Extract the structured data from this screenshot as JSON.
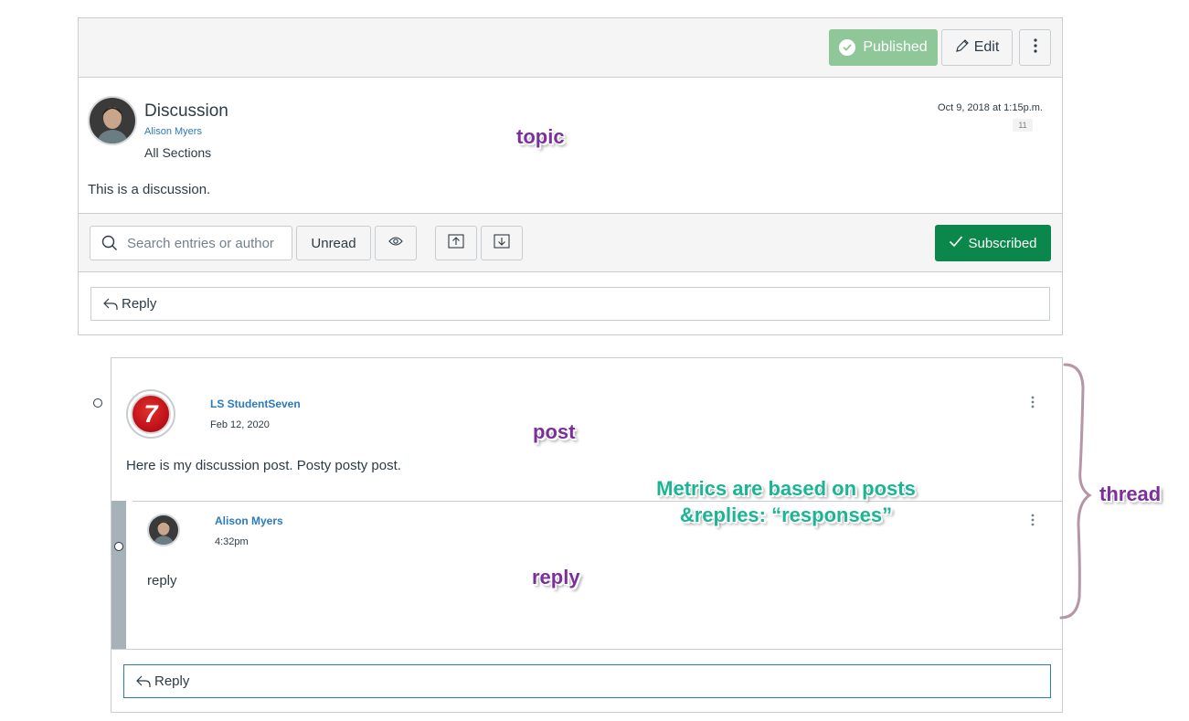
{
  "topic": {
    "published_label": "Published",
    "edit_label": "Edit",
    "title": "Discussion",
    "author": "Alison Myers",
    "sections": "All Sections",
    "date": "Oct 9, 2018 at 1:15p.m.",
    "count": "11",
    "body": "This is a discussion."
  },
  "toolbar": {
    "search_placeholder": "Search entries or author",
    "unread_label": "Unread",
    "subscribed_label": "Subscribed"
  },
  "topic_reply": {
    "label": "Reply"
  },
  "thread": {
    "post": {
      "avatar_text": "7",
      "author": "LS StudentSeven",
      "date": "Feb 12, 2020",
      "body": "Here is my discussion post. Posty posty post."
    },
    "reply": {
      "author": "Alison Myers",
      "date": "4:32pm",
      "body": "reply"
    },
    "reply_bar_label": "Reply"
  },
  "annotations": {
    "topic": "topic",
    "post": "post",
    "reply": "reply",
    "thread": "thread",
    "metrics_line1": "Metrics are based on posts",
    "metrics_line2": "&replies: “responses”"
  },
  "colors": {
    "published": "#8fc799",
    "subscribed": "#0b874b",
    "link": "#2b7abc",
    "annotation_purple": "#7b2f9b",
    "annotation_green": "#1bb594"
  }
}
